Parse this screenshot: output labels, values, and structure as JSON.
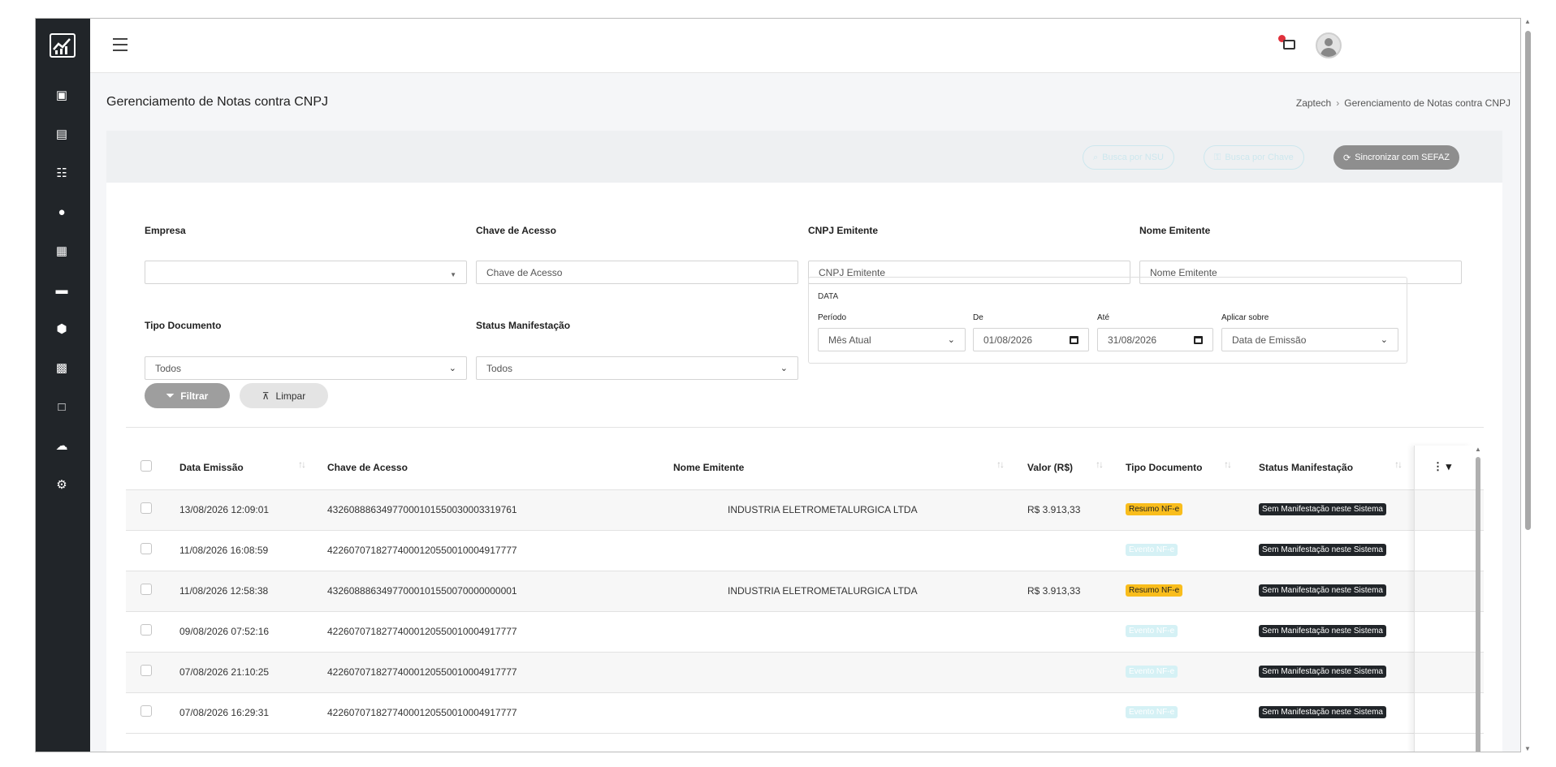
{
  "sidebar": {
    "items": [
      {
        "icon": "inbox-icon",
        "glyph": "▣"
      },
      {
        "icon": "card-icon",
        "glyph": "▤"
      },
      {
        "icon": "cart-icon",
        "glyph": "☷"
      },
      {
        "icon": "coin-icon",
        "glyph": "●"
      },
      {
        "icon": "document-icon",
        "glyph": "▦"
      },
      {
        "icon": "folder-icon",
        "glyph": "▬"
      },
      {
        "icon": "box-icon",
        "glyph": "⬢"
      },
      {
        "icon": "ticket-icon",
        "glyph": "▩"
      },
      {
        "icon": "book-icon",
        "glyph": "□"
      },
      {
        "icon": "cloud-icon",
        "glyph": "☁"
      },
      {
        "icon": "gear-icon",
        "glyph": "⚙"
      }
    ]
  },
  "page": {
    "title": "Gerenciamento de Notas contra CNPJ",
    "breadcrumb": [
      "Zaptech",
      "Gerenciamento de Notas contra CNPJ"
    ]
  },
  "header_buttons": {
    "by_nsu": "Busca por NSU",
    "by_key": "Busca por Chave",
    "sync": "Sincronizar com SEFAZ"
  },
  "filters": {
    "empresa": {
      "label": "Empresa",
      "value": ""
    },
    "chave": {
      "label": "Chave de Acesso",
      "placeholder": "Chave de Acesso"
    },
    "cnpj": {
      "label": "CNPJ Emitente",
      "placeholder": "CNPJ Emitente"
    },
    "nome": {
      "label": "Nome Emitente",
      "placeholder": "Nome Emitente"
    },
    "tipo": {
      "label": "Tipo Documento",
      "value": "Todos"
    },
    "status": {
      "label": "Status Manifestação",
      "value": "Todos"
    },
    "data": {
      "title": "DATA",
      "periodo_label": "Período",
      "periodo_value": "Mês Atual",
      "de_label": "De",
      "de_value": "01/08/2026",
      "ate_label": "Até",
      "ate_value": "31/08/2026",
      "aplicar_label": "Aplicar sobre",
      "aplicar_value": "Data de Emissão"
    },
    "filter_button": "Filtrar",
    "clear_button": "Limpar"
  },
  "table": {
    "columns": [
      "Data Emissão",
      "Chave de Acesso",
      "Nome Emitente",
      "Valor (R$)",
      "Tipo Documento",
      "Status Manifestação"
    ],
    "actions_header": "⋮ ▾",
    "rows": [
      {
        "data": "13/08/2026 12:09:01",
        "chave": "43260888634977000101550030003319761",
        "nome": "INDUSTRIA ELETROMETALURGICA LTDA",
        "valor": "R$ 3.913,33",
        "tipo": "Resumo NF-e",
        "status": "Sem Manifestação neste Sistema"
      },
      {
        "data": "11/08/2026 16:08:59",
        "chave": "42260707182774000120550010004917777",
        "nome": "",
        "valor": "",
        "tipo": "Evento NF-e",
        "status": "Sem Manifestação neste Sistema"
      },
      {
        "data": "11/08/2026 12:58:38",
        "chave": "43260888634977000101550070000000001",
        "nome": "INDUSTRIA ELETROMETALURGICA LTDA",
        "valor": "R$ 3.913,33",
        "tipo": "Resumo NF-e",
        "status": "Sem Manifestação neste Sistema"
      },
      {
        "data": "09/08/2026 07:52:16",
        "chave": "42260707182774000120550010004917777",
        "nome": "",
        "valor": "",
        "tipo": "Evento NF-e",
        "status": "Sem Manifestação neste Sistema"
      },
      {
        "data": "07/08/2026 21:10:25",
        "chave": "42260707182774000120550010004917777",
        "nome": "",
        "valor": "",
        "tipo": "Evento NF-e",
        "status": "Sem Manifestação neste Sistema"
      },
      {
        "data": "07/08/2026 16:29:31",
        "chave": "42260707182774000120550010004917777",
        "nome": "",
        "valor": "",
        "tipo": "Evento NF-e",
        "status": "Sem Manifestação neste Sistema"
      }
    ]
  }
}
